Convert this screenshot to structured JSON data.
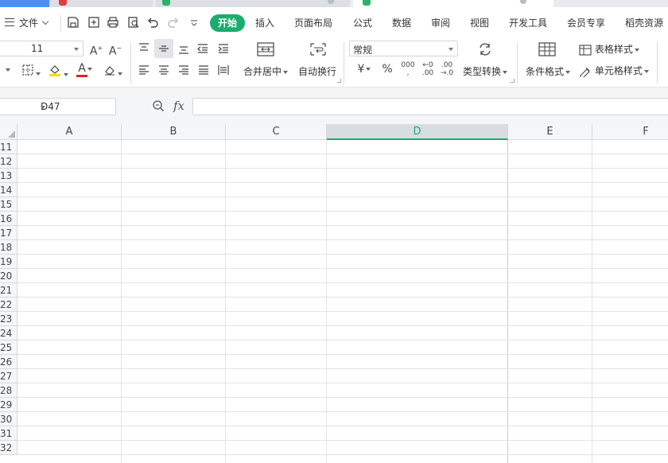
{
  "menubar": {
    "file_label": "文件",
    "tabs": [
      "开始",
      "插入",
      "页面布局",
      "公式",
      "数据",
      "审阅",
      "视图",
      "开发工具",
      "会员专享",
      "稻壳资源"
    ]
  },
  "ribbon": {
    "font_size": "11",
    "merge_label": "合并居中",
    "wrap_label": "自动换行",
    "number_format": "常规",
    "type_convert_label": "类型转换",
    "cond_format_label": "条件格式",
    "table_style_label": "表格样式",
    "cell_style_label": "单元格样式",
    "font_color": "#e02020",
    "fill_color": "#f5e000"
  },
  "formula_bar": {
    "cell_ref": "D47",
    "fx_label": "fx",
    "formula_value": ""
  },
  "grid": {
    "columns": [
      "A",
      "B",
      "C",
      "D",
      "E",
      "F"
    ],
    "selected_column": "D",
    "rows": [
      "11",
      "12",
      "13",
      "14",
      "15",
      "16",
      "17",
      "18",
      "19",
      "20",
      "21",
      "22",
      "23",
      "24",
      "25",
      "26",
      "27",
      "28",
      "29",
      "30",
      "31",
      "32"
    ]
  },
  "accent_color": "#1aad6d"
}
